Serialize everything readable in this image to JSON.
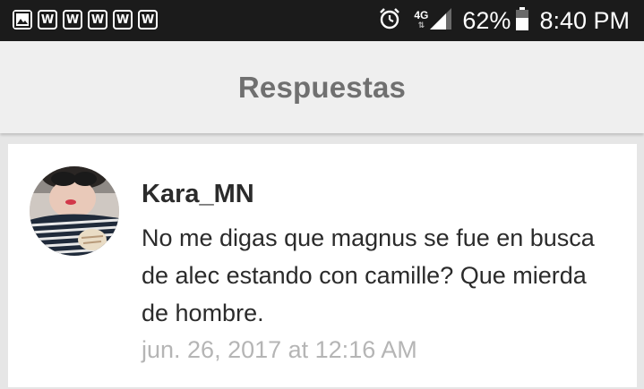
{
  "status_bar": {
    "notification_icons": [
      "gallery-icon",
      "w-app-icon",
      "w-app-icon",
      "w-app-icon",
      "w-app-icon",
      "w-app-icon"
    ],
    "w_letter": "W",
    "network": "4G",
    "battery": "62%",
    "time": "8:40 PM"
  },
  "app_bar": {
    "title": "Respuestas"
  },
  "comment": {
    "username": "Kara_MN",
    "text": "No me digas que magnus se fue en busca de alec estando con camille? Que mierda de hombre.",
    "timestamp": "jun. 26, 2017 at 12:16 AM"
  }
}
